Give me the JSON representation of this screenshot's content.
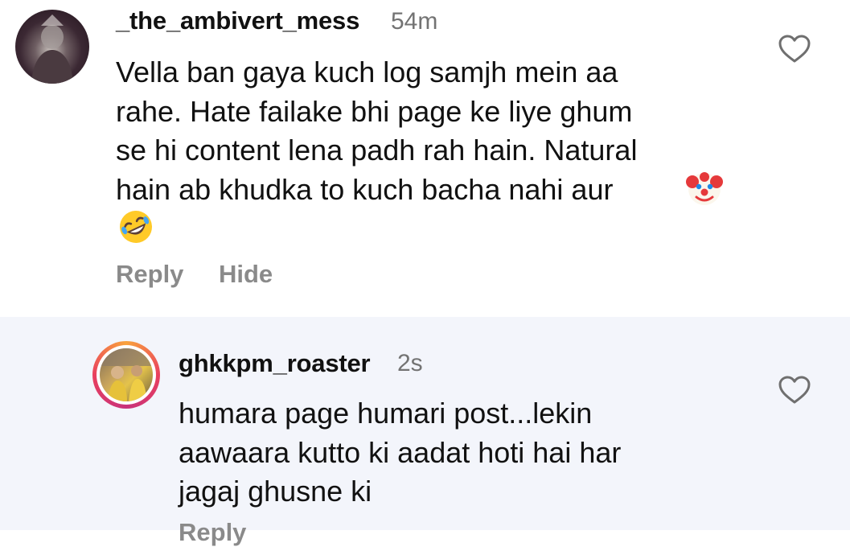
{
  "comments": [
    {
      "username": "_the_ambivert_mess",
      "timestamp": "54m",
      "text": "Vella ban gaya kuch log samjh mein aa\nrahe. Hate failake bhi page ke liye ghum\nse hi content lena padh rah hain. Natural\nhain ab khudka to kuch bacha nahi aur",
      "emojis": [
        "clown-face",
        "rolling-on-floor-laughing"
      ],
      "actions": {
        "reply": "Reply",
        "hide": "Hide"
      }
    },
    {
      "username": "ghkkpm_roaster",
      "timestamp": "2s",
      "text": "humara page humari post...lekin\naawaara kutto ki aadat hoti hai har\njagaj ghusne ki",
      "actions": {
        "reply": "Reply"
      }
    }
  ],
  "colors": {
    "reply_background": "#f3f5fb",
    "muted_text": "#737373",
    "action_text": "#8a8a8a",
    "story_ring": [
      "#f9a23c",
      "#e9405e",
      "#c8327a"
    ]
  }
}
